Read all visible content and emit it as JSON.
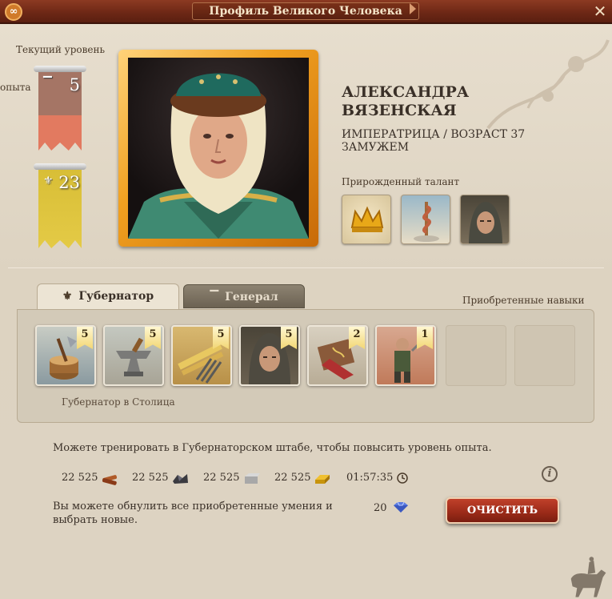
{
  "window": {
    "title": "Профиль Великого Человека",
    "logo_icon": "swirl-logo-icon",
    "close_icon": "close-icon"
  },
  "level": {
    "current_level_label": "Текущий уровень",
    "experience_label": "опыта",
    "level_value": "5",
    "experience_value": "23",
    "level_icon": "helmet-icon",
    "experience_icon": "fleur-de-lis-icon",
    "level_banner_colors": [
      "#a87060",
      "#e27a62"
    ],
    "experience_banner_color": "#e2c840"
  },
  "profile": {
    "name_line1": "АЛЕКСАНДРА",
    "name_line2": "ВЯЗЕНСКАЯ",
    "title_line": "ИМПЕРАТРИЦА / ВОЗРАСТ 37",
    "status_line": "ЗАМУЖЕМ",
    "portrait_icon": "woman-portrait-image"
  },
  "talent": {
    "label": "Прирожденный талант",
    "items": [
      {
        "icon": "crown-icon"
      },
      {
        "icon": "caduceus-icon"
      },
      {
        "icon": "hooded-man-icon"
      }
    ]
  },
  "tabs": [
    {
      "label": "Губернатор",
      "icon": "fleur-de-lis-icon",
      "active": true
    },
    {
      "label": "Генерал",
      "icon": "helmet-icon",
      "active": false
    }
  ],
  "skills": {
    "header": "Приобретенные навыки",
    "items": [
      {
        "icon": "chopping-block-icon",
        "level": "5"
      },
      {
        "icon": "anvil-icon",
        "level": "5"
      },
      {
        "icon": "wheat-pitchfork-icon",
        "level": "5"
      },
      {
        "icon": "hooded-man-icon",
        "level": "5"
      },
      {
        "icon": "scroll-book-icon",
        "level": "2"
      },
      {
        "icon": "warrior-icon",
        "level": "1"
      },
      {
        "icon": "empty-slot",
        "level": ""
      },
      {
        "icon": "empty-slot",
        "level": ""
      }
    ],
    "location_text": "Губернатор в Столица"
  },
  "training": {
    "hint": "Можете тренировать в Губернаторском штабе, чтобы повысить уровень опыта.",
    "resources": [
      {
        "value": "22 525",
        "icon": "wood-icon"
      },
      {
        "value": "22 525",
        "icon": "iron-ore-icon"
      },
      {
        "value": "22 525",
        "icon": "stone-icon"
      },
      {
        "value": "22 525",
        "icon": "gold-icon"
      }
    ],
    "time": "01:57:35",
    "time_icon": "clock-icon",
    "info_icon": "info-icon"
  },
  "reset": {
    "text_line1": "Вы можете обнулить все приобретенные умения и",
    "text_line2": "выбрать новые.",
    "cost": "20",
    "cost_icon": "gem-icon",
    "button_label": "ОЧИСТИТЬ"
  }
}
